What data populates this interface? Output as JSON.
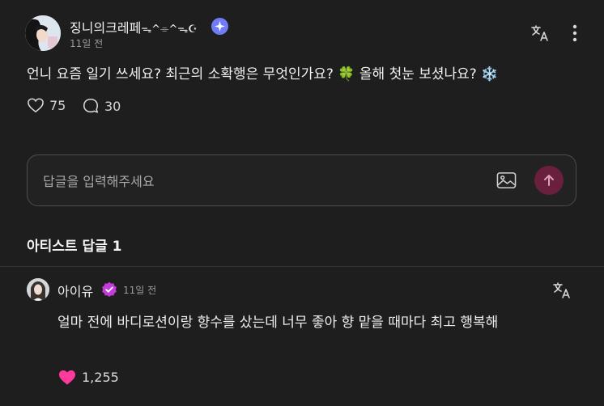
{
  "post": {
    "username": "징니의크레페",
    "username_decoration": "ᯓ^⌯^ᯓ☪",
    "timestamp": "11일 전",
    "text": "언니 요즘 일기 쓰세요? 최근의 소확행은 무엇인가요? 🍀 올해 첫눈 보셨나요? ❄️",
    "likes": "75",
    "comments": "30"
  },
  "reply_input": {
    "placeholder": "답글을 입력해주세요"
  },
  "artist_replies": {
    "title": "아티스트 답글 1",
    "items": [
      {
        "name": "아이유",
        "timestamp": "11일 전",
        "text": "얼마 전에 바디로션이랑 향수를 샀는데 너무 좋아 향 맡을 때마다 최고 행복해",
        "likes": "1,255"
      }
    ]
  },
  "colors": {
    "background": "#1e1e1e",
    "badge_blue": "#6f7cf5",
    "badge_pink": "#c43bdc",
    "heart_pink": "#ff3a9d",
    "send_button": "#6a1f3c"
  }
}
